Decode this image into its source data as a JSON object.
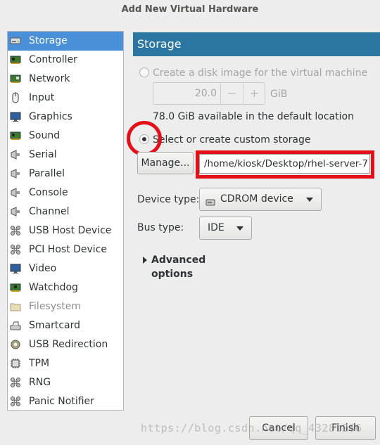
{
  "window": {
    "title": "Add New Virtual Hardware"
  },
  "sidebar": {
    "items": [
      {
        "label": "Storage",
        "icon": "storage-icon",
        "selected": true
      },
      {
        "label": "Controller",
        "icon": "controller-icon"
      },
      {
        "label": "Network",
        "icon": "network-icon"
      },
      {
        "label": "Input",
        "icon": "mouse-icon"
      },
      {
        "label": "Graphics",
        "icon": "monitor-icon"
      },
      {
        "label": "Sound",
        "icon": "sound-card-icon"
      },
      {
        "label": "Serial",
        "icon": "serial-port-icon"
      },
      {
        "label": "Parallel",
        "icon": "parallel-port-icon"
      },
      {
        "label": "Console",
        "icon": "console-icon"
      },
      {
        "label": "Channel",
        "icon": "channel-icon"
      },
      {
        "label": "USB Host Device",
        "icon": "usb-icon"
      },
      {
        "label": "PCI Host Device",
        "icon": "pci-icon"
      },
      {
        "label": "Video",
        "icon": "video-icon"
      },
      {
        "label": "Watchdog",
        "icon": "watchdog-icon"
      },
      {
        "label": "Filesystem",
        "icon": "folder-icon",
        "disabled": true
      },
      {
        "label": "Smartcard",
        "icon": "smartcard-icon"
      },
      {
        "label": "USB Redirection",
        "icon": "usb-redirection-icon"
      },
      {
        "label": "TPM",
        "icon": "chip-icon"
      },
      {
        "label": "RNG",
        "icon": "rng-icon"
      },
      {
        "label": "Panic Notifier",
        "icon": "panic-icon"
      }
    ]
  },
  "storage": {
    "header": "Storage",
    "create_image_label": "Create a disk image for the virtual machine",
    "size_value": "20.0",
    "size_minus": "−",
    "size_plus": "+",
    "size_unit": "GiB",
    "available_text": "78.0 GiB available in the default location",
    "custom_storage_label": "Select or create custom storage",
    "manage_button": "Manage...",
    "path_value": "/home/kiosk/Desktop/rhel-server-7",
    "device_type_label": "Device type:",
    "device_type_value": "CDROM device",
    "bus_type_label": "Bus type:",
    "bus_type_value": "IDE",
    "advanced_label": "Advanced options",
    "selected_option": "custom"
  },
  "footer": {
    "cancel_button": "Cancel",
    "finish_button": "Finish"
  },
  "watermark": "https://blog.csdn.net/qq_43281266",
  "colors": {
    "header_bg": "#2b75a3",
    "selection_bg": "#4a90d9",
    "annotation_red": "#e31019"
  }
}
